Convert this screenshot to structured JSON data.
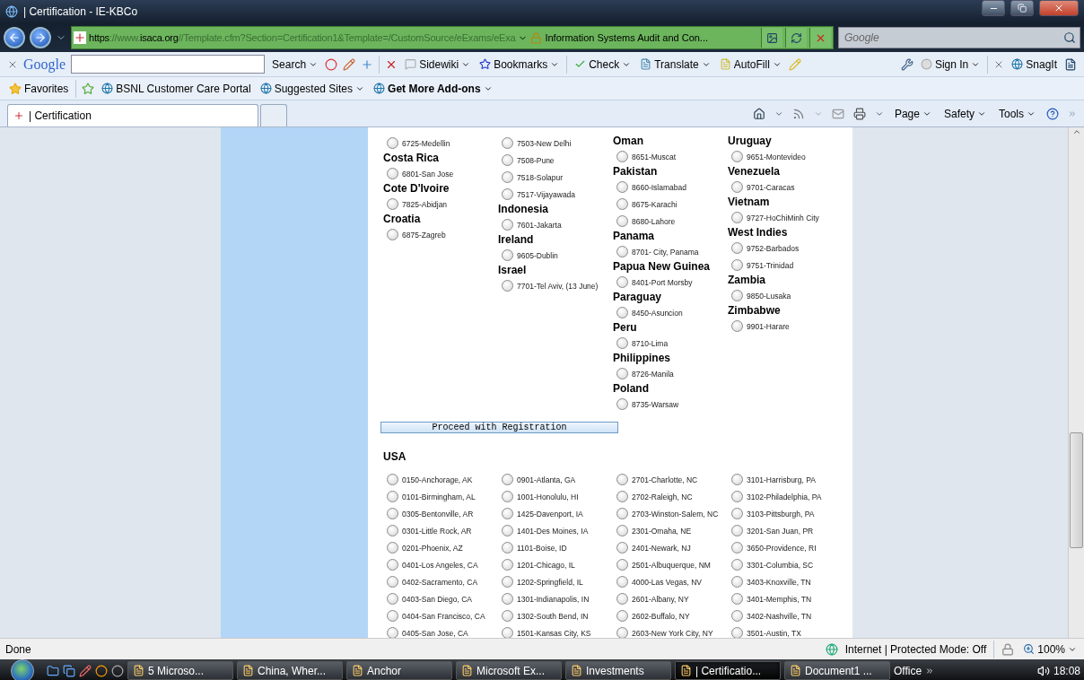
{
  "window": {
    "title": "| Certification - IE-KBCo"
  },
  "address_bar": {
    "url_parts": [
      {
        "text": "https",
        "strong": true
      },
      {
        "text": "://www.",
        "strong": false
      },
      {
        "text": "isaca.org",
        "strong": true
      },
      {
        "text": "//Template.cfm?Section=Certification1&Template=/CustomSource/eExams/eExa",
        "strong": false
      }
    ],
    "page_title": "Information Systems Audit and Con...",
    "search_placeholder": "Google"
  },
  "google_toolbar": {
    "logo": "Google",
    "search": "Search",
    "sidewiki": "Sidewiki",
    "bookmarks": "Bookmarks",
    "check": "Check",
    "translate": "Translate",
    "autofill": "AutoFill",
    "sign_in": "Sign In",
    "snagit": "SnagIt"
  },
  "favorites_bar": {
    "favorites": "Favorites",
    "links": [
      {
        "label": "BSNL Customer Care Portal",
        "bold": false,
        "dropdown": false
      },
      {
        "label": "Suggested Sites",
        "bold": false,
        "dropdown": true
      },
      {
        "label": "Get More Add-ons",
        "bold": true,
        "dropdown": true
      }
    ]
  },
  "tabs": [
    {
      "label": "| Certification",
      "selected": true
    },
    {
      "selected": false
    }
  ],
  "command_bar": [
    "Page",
    "Safety",
    "Tools"
  ],
  "page": {
    "columns": [
      {
        "groups": [
          {
            "sites": [
              {
                "label": "6725-Medellin",
                "selected": false
              }
            ]
          },
          {
            "country": "Costa Rica",
            "sites": [
              {
                "label": "6801-San Jose",
                "selected": false
              }
            ]
          },
          {
            "country": "Cote D'Ivoire",
            "sites": [
              {
                "label": "7825-Abidjan",
                "selected": false
              }
            ]
          },
          {
            "country": "Croatia",
            "sites": [
              {
                "label": "6875-Zagreb",
                "selected": false
              }
            ]
          }
        ]
      },
      {
        "groups": [
          {
            "sites": [
              {
                "label": "7503-New Delhi",
                "selected": false
              },
              {
                "label": "7508-Pune",
                "selected": false
              },
              {
                "label": "7518-Solapur",
                "selected": false
              },
              {
                "label": "7517-Vijayawada",
                "selected": false
              }
            ]
          },
          {
            "country": "Indonesia",
            "sites": [
              {
                "label": "7601-Jakarta",
                "selected": false
              }
            ]
          },
          {
            "country": "Ireland",
            "sites": [
              {
                "label": "9605-Dublin",
                "selected": false
              }
            ]
          },
          {
            "country": "Israel",
            "sites": [
              {
                "label": "7701-Tel Aviv, (13 June)",
                "selected": false
              }
            ]
          }
        ]
      },
      {
        "groups": [
          {
            "country": "Oman",
            "sites": [
              {
                "label": "8651-Muscat",
                "selected": false
              }
            ]
          },
          {
            "country": "Pakistan",
            "sites": [
              {
                "label": "8660-Islamabad",
                "selected": false
              },
              {
                "label": "8675-Karachi",
                "selected": false
              },
              {
                "label": "8680-Lahore",
                "selected": false
              }
            ]
          },
          {
            "country": "Panama",
            "sites": [
              {
                "label": "8701- City, Panama",
                "selected": false
              }
            ]
          },
          {
            "country": "Papua New Guinea",
            "sites": [
              {
                "label": "8401-Port Morsby",
                "selected": false
              }
            ]
          },
          {
            "country": "Paraguay",
            "sites": [
              {
                "label": "8450-Asuncion",
                "selected": false
              }
            ]
          },
          {
            "country": "Peru",
            "sites": [
              {
                "label": "8710-Lima",
                "selected": false
              }
            ]
          },
          {
            "country": "Philippines",
            "sites": [
              {
                "label": "8726-Manila",
                "selected": false
              }
            ]
          },
          {
            "country": "Poland",
            "sites": [
              {
                "label": "8735-Warsaw",
                "selected": false
              }
            ]
          }
        ]
      },
      {
        "groups": [
          {
            "country": "Uruguay",
            "sites": [
              {
                "label": "9651-Montevideo",
                "selected": false
              }
            ]
          },
          {
            "country": "Venezuela",
            "sites": [
              {
                "label": "9701-Caracas",
                "selected": false
              }
            ]
          },
          {
            "country": "Vietnam",
            "sites": [
              {
                "label": "9727-HoChiMinh City",
                "selected": false
              }
            ]
          },
          {
            "country": "West Indies",
            "sites": [
              {
                "label": "9752-Barbados",
                "selected": false
              },
              {
                "label": "9751-Trinidad",
                "selected": false
              }
            ]
          },
          {
            "country": "Zambia",
            "sites": [
              {
                "label": "9850-Lusaka",
                "selected": false
              }
            ]
          },
          {
            "country": "Zimbabwe",
            "sites": [
              {
                "label": "9901-Harare",
                "selected": false
              }
            ]
          }
        ]
      }
    ],
    "proceed_button": "Proceed with Registration",
    "usa": {
      "heading": "USA",
      "columns": [
        {
          "sites": [
            {
              "label": "0150-Anchorage, AK",
              "selected": false
            },
            {
              "label": "0101-Birmingham, AL",
              "selected": false
            },
            {
              "label": "0305-Bentonville, AR",
              "selected": false
            },
            {
              "label": "0301-Little Rock, AR",
              "selected": false
            },
            {
              "label": "0201-Phoenix, AZ",
              "selected": false
            },
            {
              "label": "0401-Los Angeles, CA",
              "selected": false
            },
            {
              "label": "0402-Sacramento, CA",
              "selected": false
            },
            {
              "label": "0403-San Diego, CA",
              "selected": false
            },
            {
              "label": "0404-San Francisco, CA",
              "selected": false
            },
            {
              "label": "0405-San Jose, CA",
              "selected": false
            }
          ]
        },
        {
          "sites": [
            {
              "label": "0901-Atlanta, GA",
              "selected": false
            },
            {
              "label": "1001-Honolulu, HI",
              "selected": false
            },
            {
              "label": "1425-Davenport, IA",
              "selected": false
            },
            {
              "label": "1401-Des Moines, IA",
              "selected": false
            },
            {
              "label": "1101-Boise, ID",
              "selected": false
            },
            {
              "label": "1201-Chicago, IL",
              "selected": false
            },
            {
              "label": "1202-Springfield, IL",
              "selected": false
            },
            {
              "label": "1301-Indianapolis, IN",
              "selected": false
            },
            {
              "label": "1302-South Bend, IN",
              "selected": false
            },
            {
              "label": "1501-Kansas City, KS",
              "selected": false
            }
          ]
        },
        {
          "sites": [
            {
              "label": "2701-Charlotte, NC",
              "selected": false
            },
            {
              "label": "2702-Raleigh, NC",
              "selected": false
            },
            {
              "label": "2703-Winston-Salem, NC",
              "selected": false
            },
            {
              "label": "2301-Omaha, NE",
              "selected": false
            },
            {
              "label": "2401-Newark, NJ",
              "selected": false
            },
            {
              "label": "2501-Albuquerque, NM",
              "selected": false
            },
            {
              "label": "4000-Las Vegas, NV",
              "selected": false
            },
            {
              "label": "2601-Albany, NY",
              "selected": false
            },
            {
              "label": "2602-Buffalo, NY",
              "selected": false
            },
            {
              "label": "2603-New York City, NY",
              "selected": false
            }
          ]
        },
        {
          "sites": [
            {
              "label": "3101-Harrisburg, PA",
              "selected": false
            },
            {
              "label": "3102-Philadelphia, PA",
              "selected": false
            },
            {
              "label": "3103-Pittsburgh, PA",
              "selected": false
            },
            {
              "label": "3201-San Juan, PR",
              "selected": false
            },
            {
              "label": "3650-Providence, RI",
              "selected": false
            },
            {
              "label": "3301-Columbia, SC",
              "selected": false
            },
            {
              "label": "3403-Knoxville, TN",
              "selected": false
            },
            {
              "label": "3401-Memphis, TN",
              "selected": false
            },
            {
              "label": "3402-Nashville, TN",
              "selected": false
            },
            {
              "label": "3501-Austin, TX",
              "selected": false
            }
          ]
        }
      ]
    }
  },
  "status_bar": {
    "text": "Done",
    "zone": "Internet | Protected Mode: Off",
    "zoom": "100%"
  },
  "taskbar": {
    "tasks": [
      {
        "label": "5 Microso...",
        "selected": false
      },
      {
        "label": "China, Wher...",
        "selected": false
      },
      {
        "label": "Anchor",
        "selected": false
      },
      {
        "label": "Microsoft Ex...",
        "selected": false
      },
      {
        "label": "Investments",
        "selected": false
      },
      {
        "label": "| Certificatio...",
        "selected": true
      },
      {
        "label": "Document1 ...",
        "selected": false
      }
    ],
    "toolbar": "Office",
    "clock": "18:08"
  }
}
